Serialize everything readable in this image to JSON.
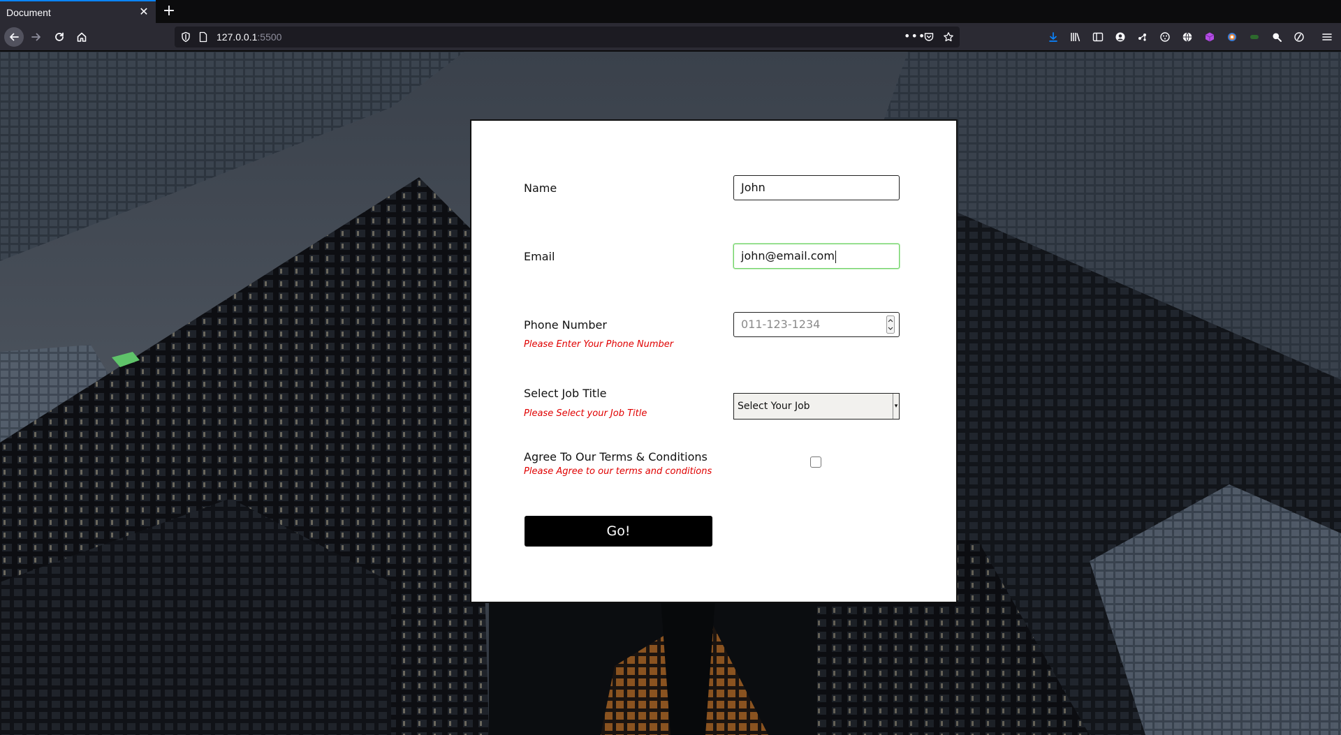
{
  "browser": {
    "tab_title": "Document",
    "tab_close_glyph": "✕",
    "new_tab_glyph": "+",
    "url_host": "127.0.0.1",
    "url_port": ":5500",
    "url_more_glyph": "•••",
    "icons": {
      "back": "back-arrow-icon",
      "forward": "forward-arrow-icon",
      "reload": "reload-icon",
      "home": "home-icon",
      "shield": "tracking-shield-icon",
      "page": "page-icon",
      "pocket": "pocket-icon",
      "bookmark": "star-icon",
      "toolbar": [
        "download-icon",
        "library-icon",
        "sidebar-icon",
        "account-icon",
        "extension-icon",
        "extension-icon",
        "globe-icon",
        "cube-icon",
        "extension-icon",
        "extension-icon",
        "search-icon",
        "extension-icon",
        "menu-icon"
      ]
    },
    "accent_color": "#0a84ff"
  },
  "form": {
    "name": {
      "label": "Name",
      "value": "John"
    },
    "email": {
      "label": "Email",
      "value": "john@email.com",
      "focus_border_color": "#74d36a"
    },
    "phone": {
      "label": "Phone Number",
      "placeholder": "011-123-1234",
      "error": "Please Enter Your Phone Number"
    },
    "job": {
      "label": "Select Job Title",
      "selected": "Select Your Job",
      "error": "Please Select your Job Title"
    },
    "terms": {
      "label": "Agree To Our Terms & Conditions",
      "checked": false,
      "error": "Please Agree to our terms and conditions"
    },
    "submit_label": "Go!",
    "error_color": "#e00000"
  }
}
